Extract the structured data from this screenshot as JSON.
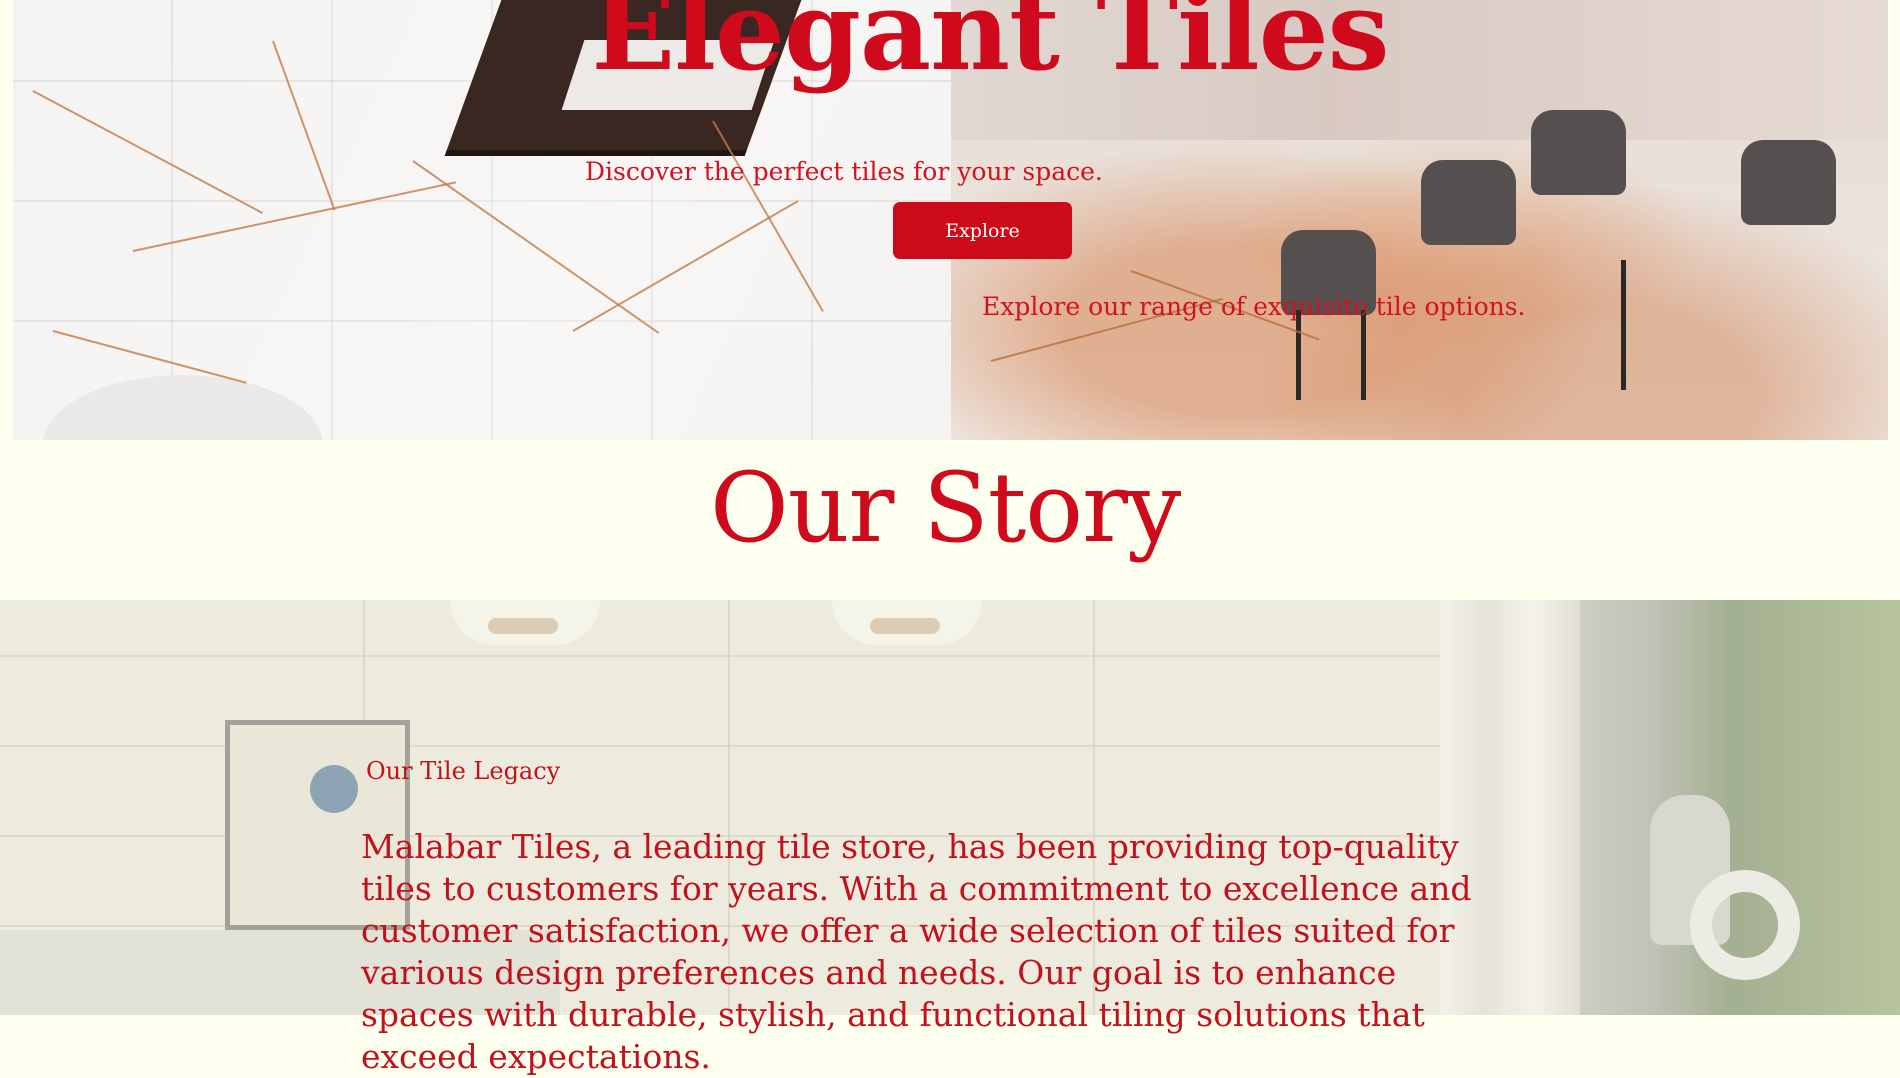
{
  "hero": {
    "title": "Elegant Tiles",
    "subtitle": "Discover the perfect tiles for your space.",
    "cta_label": "Explore",
    "tagline": "Explore our range of exquisite tile options."
  },
  "story": {
    "title": "Our Story"
  },
  "legacy": {
    "label": "Our Tile Legacy",
    "body": "Malabar Tiles, a leading tile store, has been providing top-quality tiles to customers for years. With a commitment to excellence and customer satisfaction, we offer a wide selection of tiles suited for various design preferences and needs. Our goal is to enhance spaces with durable, stylish, and functional tiling solutions that exceed expectations."
  },
  "colors": {
    "accent": "#cf0a1d",
    "button_bg": "#cc0a18",
    "page_bg": "#fdffef"
  }
}
